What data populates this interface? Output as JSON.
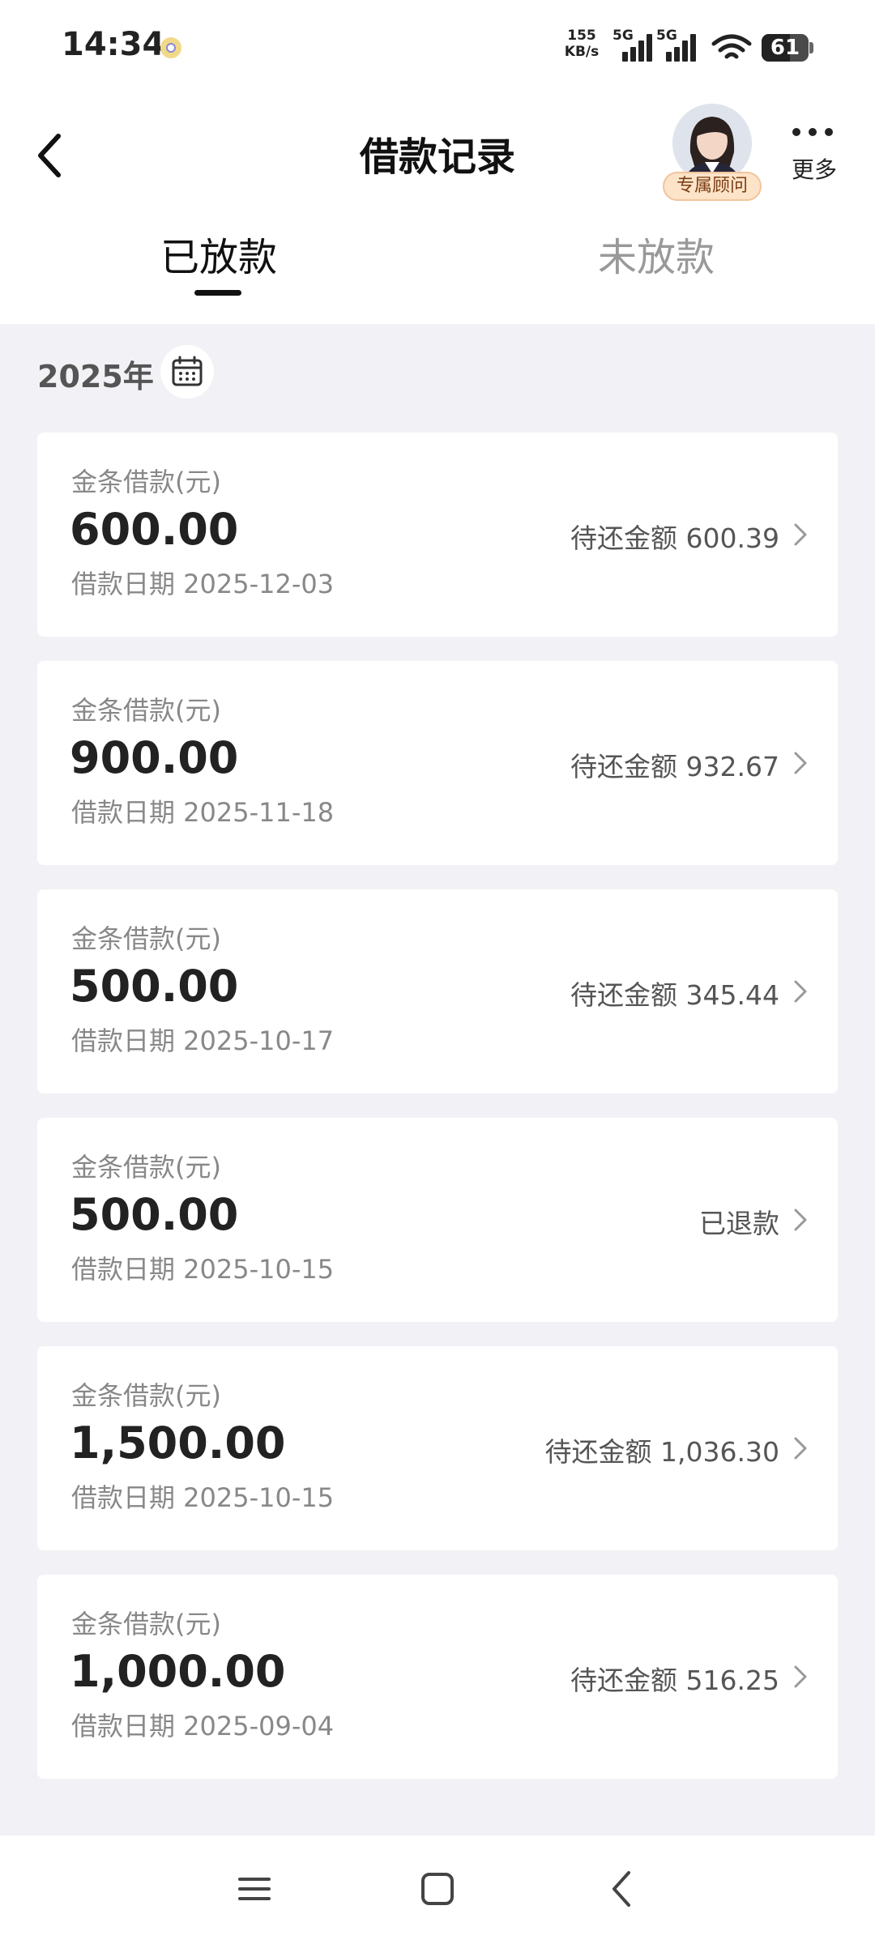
{
  "status_bar": {
    "time": "14:34",
    "net_speed_value": "155",
    "net_speed_unit": "KB/s",
    "signal1_label": "5G",
    "signal2_label": "5G",
    "battery": "61"
  },
  "header": {
    "title": "借款记录",
    "advisor_label": "专属顾问",
    "more_label": "更多"
  },
  "tabs": [
    {
      "label": "已放款",
      "active": true
    },
    {
      "label": "未放款",
      "active": false
    }
  ],
  "year_label": "2025年",
  "loans": [
    {
      "title": "金条借款(元)",
      "amount": "600.00",
      "date_text": "借款日期 2025-12-03",
      "status_text": "待还金额 600.39"
    },
    {
      "title": "金条借款(元)",
      "amount": "900.00",
      "date_text": "借款日期 2025-11-18",
      "status_text": "待还金额 932.67"
    },
    {
      "title": "金条借款(元)",
      "amount": "500.00",
      "date_text": "借款日期 2025-10-17",
      "status_text": "待还金额 345.44"
    },
    {
      "title": "金条借款(元)",
      "amount": "500.00",
      "date_text": "借款日期 2025-10-15",
      "status_text": "已退款"
    },
    {
      "title": "金条借款(元)",
      "amount": "1,500.00",
      "date_text": "借款日期 2025-10-15",
      "status_text": "待还金额 1,036.30"
    },
    {
      "title": "金条借款(元)",
      "amount": "1,000.00",
      "date_text": "借款日期 2025-09-04",
      "status_text": "待还金额 516.25"
    }
  ],
  "icons": {
    "back": "back-arrow-icon",
    "more": "more-dots-icon",
    "calendar": "calendar-icon",
    "chevron": "chevron-right-icon"
  }
}
